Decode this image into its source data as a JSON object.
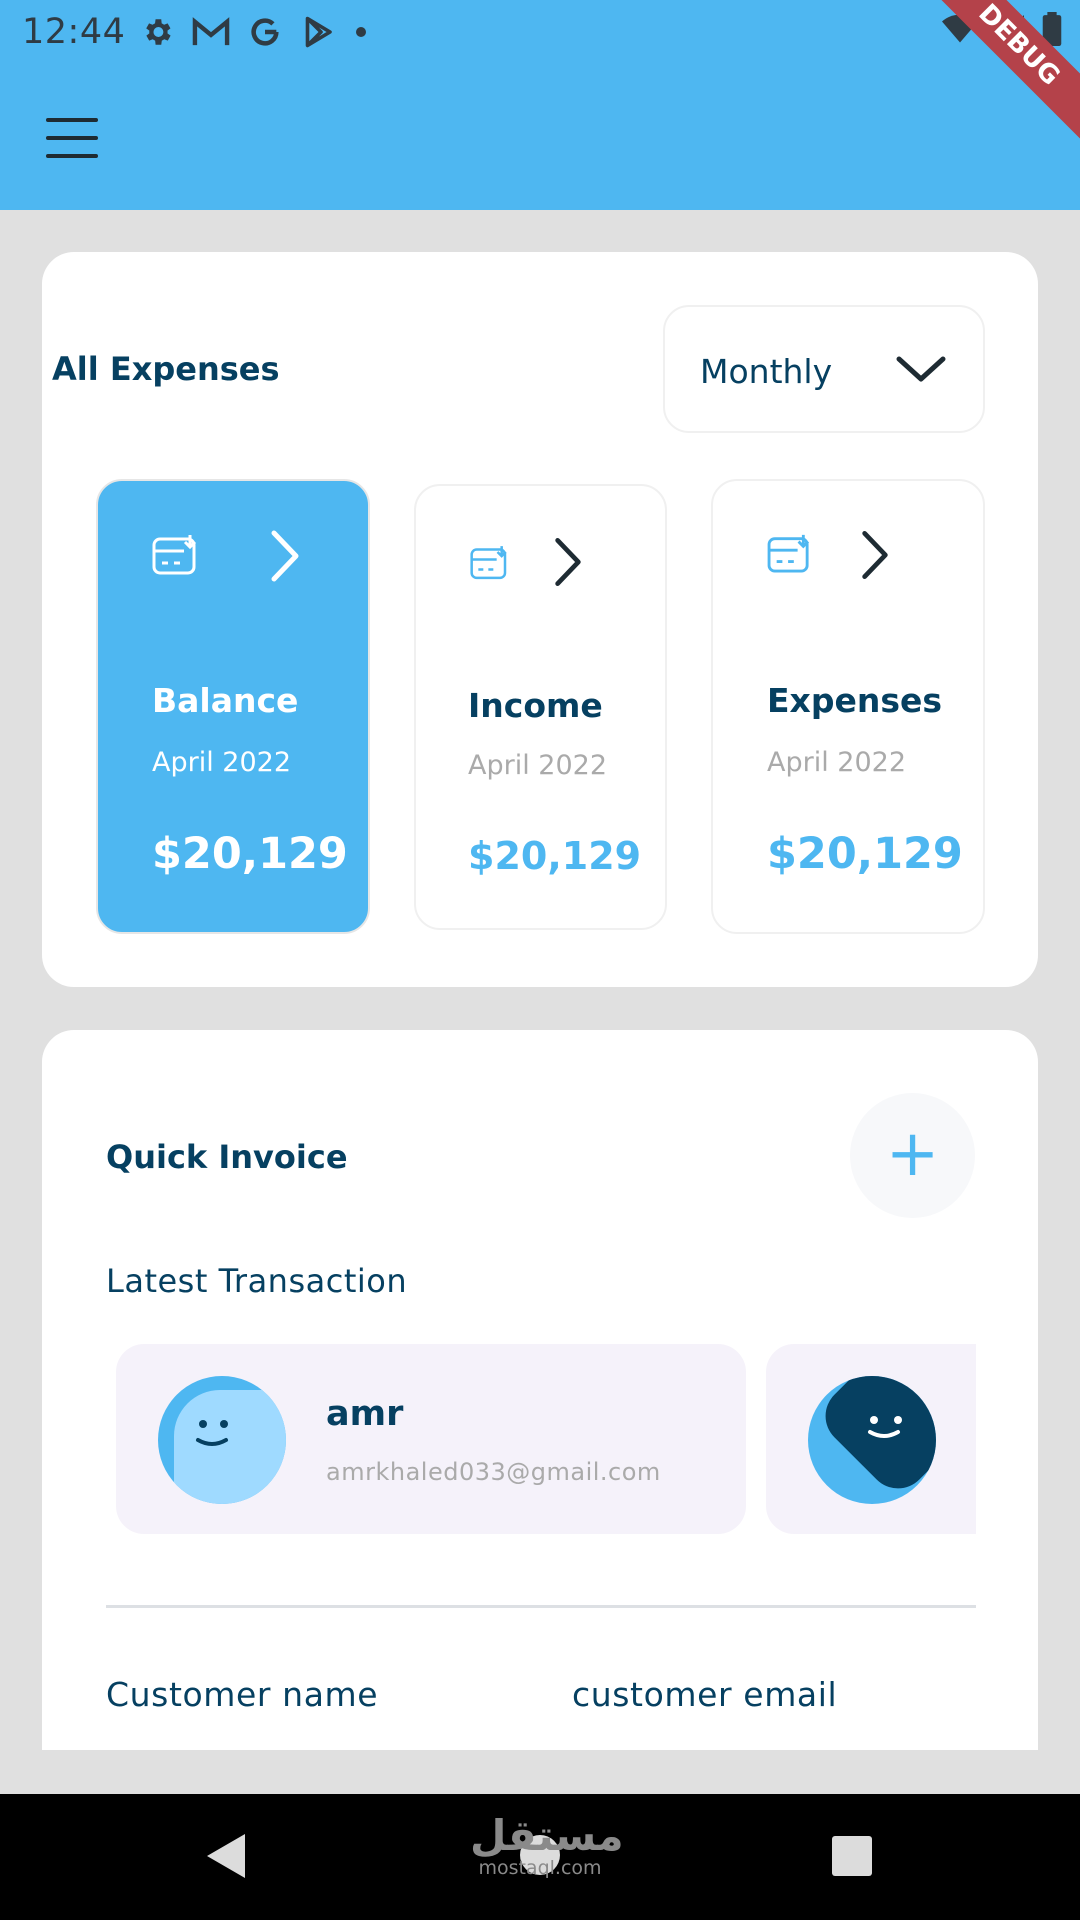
{
  "status_bar": {
    "time": "12:44",
    "left_icons": [
      "gear-icon",
      "gmail-icon",
      "google-icon",
      "play-store-icon",
      "dot-icon"
    ],
    "right_icons": [
      "wifi-icon",
      "signal-icon",
      "battery-icon"
    ],
    "debug_banner": "DEBUG"
  },
  "app_bar": {
    "menu_icon": "hamburger-menu-icon"
  },
  "all_expenses": {
    "title": "All Expenses",
    "period": "Monthly",
    "items": [
      {
        "title": "Balance",
        "date": "April 2022",
        "amount": "$20,129",
        "active": true
      },
      {
        "title": "Income",
        "date": "April 2022",
        "amount": "$20,129",
        "active": false
      },
      {
        "title": "Expenses",
        "date": "April 2022",
        "amount": "$20,129",
        "active": false
      }
    ]
  },
  "quick_invoice": {
    "title": "Quick Invoice",
    "add_icon": "plus-icon",
    "latest_label": "Latest Transaction",
    "transactions": [
      {
        "name": "amr",
        "email": "amrkhaled033@gmail.com"
      },
      {
        "name": "",
        "email": ""
      }
    ],
    "customer_name_label": "Customer name",
    "customer_email_label": "customer email"
  },
  "nav_bar": {
    "icons": [
      "back-icon",
      "home-icon",
      "recents-icon"
    ],
    "watermark": {
      "mark": "مستقل",
      "text": "mostaql.com"
    }
  },
  "colors": {
    "accent": "#4eb7f1",
    "primary_text": "#064061",
    "secondary_text": "#aaaaaa",
    "page_background": "#e0e0e0",
    "transaction_background": "#f5f2fa"
  }
}
